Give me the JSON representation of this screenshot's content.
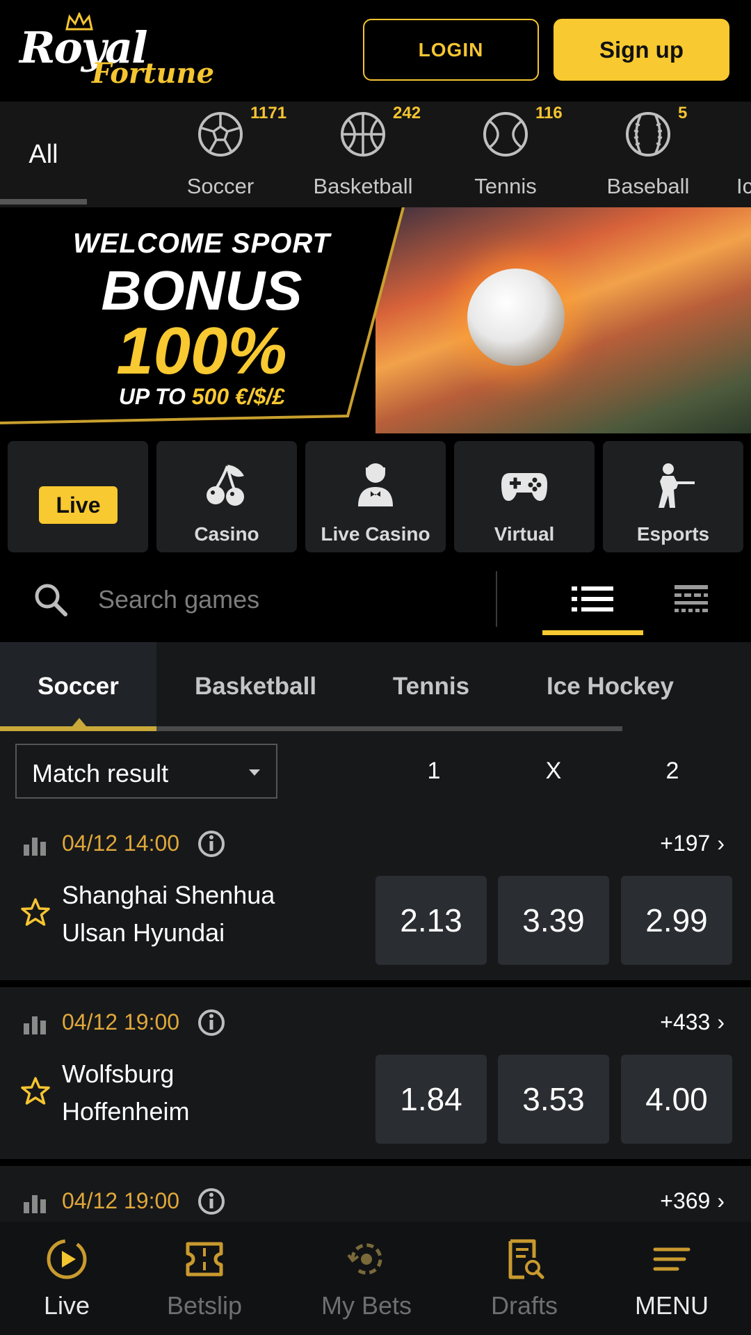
{
  "header": {
    "logo_top": "Royal",
    "logo_bottom": "Fortune",
    "login_label": "LOGIN",
    "signup_label": "Sign up"
  },
  "sports_nav": {
    "all_label": "All",
    "items": [
      {
        "label": "Soccer",
        "count": "1171",
        "icon": "soccer-ball-icon"
      },
      {
        "label": "Basketball",
        "count": "242",
        "icon": "basketball-icon"
      },
      {
        "label": "Tennis",
        "count": "116",
        "icon": "tennis-ball-icon"
      },
      {
        "label": "Baseball",
        "count": "5",
        "icon": "baseball-icon"
      },
      {
        "label": "Ic",
        "count": "",
        "icon": ""
      }
    ]
  },
  "banner": {
    "line1": "WELCOME SPORT",
    "line2": "BONUS",
    "line3": "100%",
    "line4_prefix": "UP TO ",
    "line4_amount": "500 €/$/£"
  },
  "categories": [
    {
      "label": "Live",
      "icon": "live-badge"
    },
    {
      "label": "Casino",
      "icon": "cherries-icon"
    },
    {
      "label": "Live Casino",
      "icon": "dealer-icon"
    },
    {
      "label": "Virtual",
      "icon": "gamepad-icon"
    },
    {
      "label": "Esports",
      "icon": "soldier-icon"
    }
  ],
  "search": {
    "placeholder": "Search games"
  },
  "sport_tabs": {
    "items": [
      "Soccer",
      "Basketball",
      "Tennis",
      "Ice Hockey"
    ],
    "active": "Soccer"
  },
  "market": {
    "selected": "Match result",
    "columns": [
      "1",
      "X",
      "2"
    ]
  },
  "matches": [
    {
      "time": "04/12 14:00",
      "more": "+197",
      "team1": "Shanghai Shenhua",
      "team2": "Ulsan Hyundai",
      "odds": [
        "2.13",
        "3.39",
        "2.99"
      ]
    },
    {
      "time": "04/12 19:00",
      "more": "+433",
      "team1": "Wolfsburg",
      "team2": "Hoffenheim",
      "odds": [
        "1.84",
        "3.53",
        "4.00"
      ]
    },
    {
      "time": "04/12 19:00",
      "more": "+369",
      "team1": "",
      "team2": "",
      "odds": []
    }
  ],
  "bottom_nav": [
    {
      "label": "Live",
      "icon": "live-play-icon"
    },
    {
      "label": "Betslip",
      "icon": "betslip-icon"
    },
    {
      "label": "My Bets",
      "icon": "history-icon"
    },
    {
      "label": "Drafts",
      "icon": "drafts-icon"
    },
    {
      "label": "MENU",
      "icon": "menu-icon"
    }
  ],
  "colors": {
    "accent": "#f8c930",
    "background": "#000000",
    "panel": "#17181a",
    "odds_bg": "#2a2d31",
    "time_text": "#e0a83a"
  }
}
